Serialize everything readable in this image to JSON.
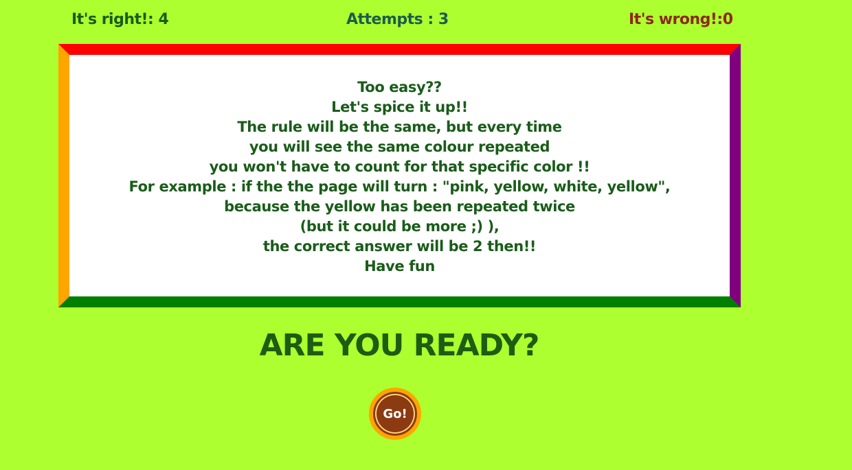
{
  "scoreboard": {
    "right_label": "It's right!: 4",
    "attempts_label": "Attempts : 3",
    "wrong_label": "It's wrong!:0"
  },
  "instructions": {
    "lines": [
      "Too easy??",
      "Let's spice it up!!",
      "The rule will be the same, but every time",
      "you will see the same colour repeated",
      "you won't have to count for that specific color !!",
      "For example : if the the page will turn : \"pink, yellow, white, yellow\",",
      "because the yellow has been repeated twice",
      "(but it could be more ;) ),",
      "the correct answer will be 2 then!!",
      "Have fun"
    ]
  },
  "frame_colors": {
    "top": "#ff0000",
    "right": "#800080",
    "bottom": "#008000",
    "left": "#ffa500"
  },
  "ready_heading": "ARE YOU READY?",
  "go_button_label": "Go!",
  "colors": {
    "background": "#adff2f",
    "text_green": "#1a5c1a",
    "wrong_red": "#8b2a1a",
    "button_brown": "#8b3a12",
    "button_ring": "#ffa500"
  }
}
